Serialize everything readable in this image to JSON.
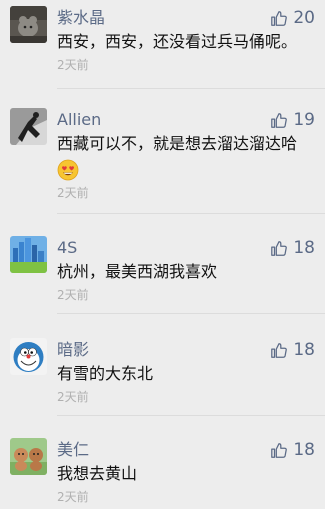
{
  "comments": [
    {
      "name": "紫水晶",
      "text": "西安，西安，还没看过兵马俑呢。",
      "time": "2天前",
      "likes": "20"
    },
    {
      "name": "Allien",
      "text": "西藏可以不，就是想去溜达溜达哈",
      "time": "2天前",
      "likes": "19",
      "emoji": "heart-eyes-emoji"
    },
    {
      "name": "4S",
      "text": "杭州，最美西湖我喜欢",
      "time": "2天前",
      "likes": "18"
    },
    {
      "name": "暗影",
      "text": "有雪的大东北",
      "time": "2天前",
      "likes": "18"
    },
    {
      "name": "美仁",
      "text": "我想去黄山",
      "time": "2天前",
      "likes": "18"
    }
  ],
  "colors": {
    "background": "#ededed",
    "name": "#5b6a86",
    "text": "#111111",
    "time": "#b0b0b0"
  },
  "icons": {
    "like": "thumbs-up-icon"
  }
}
